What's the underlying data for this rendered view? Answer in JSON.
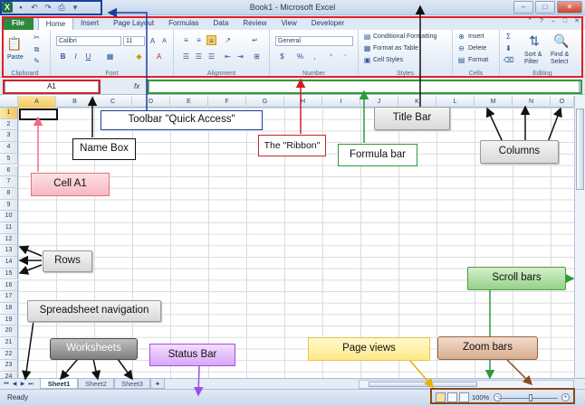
{
  "window": {
    "title": "Book1 - Microsoft Excel",
    "controls": [
      "–",
      "□",
      "✕"
    ]
  },
  "quick_access": {
    "icons": [
      "excel-logo-icon",
      "save-icon",
      "undo-icon",
      "redo-icon",
      "quick-print-icon",
      "customize-qat-icon"
    ]
  },
  "tabs": [
    "File",
    "Home",
    "Insert",
    "Page Layout",
    "Formulas",
    "Data",
    "Review",
    "View",
    "Developer"
  ],
  "active_tab": "Home",
  "ribbon": {
    "clipboard": {
      "label": "Clipboard",
      "paste": "Paste"
    },
    "font": {
      "label": "Font",
      "name": "Calibri",
      "size": "11",
      "bold": "B",
      "italic": "I",
      "underline": "U"
    },
    "alignment": {
      "label": "Alignment"
    },
    "number": {
      "label": "Number",
      "format": "General",
      "currency": "$",
      "percent": "%",
      "comma": ","
    },
    "styles": {
      "label": "Styles",
      "conditional": "Conditional Formatting",
      "table": "Format as Table",
      "cell": "Cell Styles"
    },
    "cells": {
      "label": "Cells",
      "insert": "Insert",
      "delete": "Delete",
      "format": "Format"
    },
    "editing": {
      "label": "Editing",
      "sort": "Sort &",
      "sort2": "Filter",
      "find": "Find &",
      "find2": "Select"
    }
  },
  "formula_bar": {
    "name_box": "A1",
    "fx": "fx",
    "content": ""
  },
  "columns": [
    "A",
    "B",
    "C",
    "D",
    "E",
    "F",
    "G",
    "H",
    "I",
    "J",
    "K",
    "L",
    "M",
    "N",
    "O"
  ],
  "rows": [
    "1",
    "2",
    "3",
    "4",
    "5",
    "6",
    "7",
    "8",
    "9",
    "10",
    "11",
    "12",
    "13",
    "14",
    "15",
    "16",
    "17",
    "18",
    "19",
    "20",
    "21",
    "22",
    "23",
    "24"
  ],
  "selected_cell": "A1",
  "sheets": [
    "Sheet1",
    "Sheet2",
    "Sheet3"
  ],
  "active_sheet": "Sheet1",
  "status": {
    "ready": "Ready",
    "zoom": "100%"
  },
  "annotations": {
    "title_bar": "Title Bar",
    "quick_access": "Toolbar  \"Quick Access\"",
    "name_box": "Name Box",
    "ribbon": "The \"Ribbon\"",
    "formula_bar": "Formula bar",
    "columns": "Columns",
    "cell_a1": "Cell A1",
    "rows": "Rows",
    "spreadsheet_navigation": "Spreadsheet navigation",
    "worksheets": "Worksheets",
    "status_bar": "Status Bar",
    "page_views": "Page views",
    "zoom_bars": "Zoom bars",
    "scroll_bars": "Scroll bars"
  },
  "colors": {
    "ribbon_highlight": "#e31e24",
    "qat_highlight": "#1c3f9e",
    "formula_highlight": "#2f9a3a",
    "status_highlight": "#8a4a18",
    "file_tab": "#2b8a3e",
    "selected_header": "#f5c65c"
  }
}
